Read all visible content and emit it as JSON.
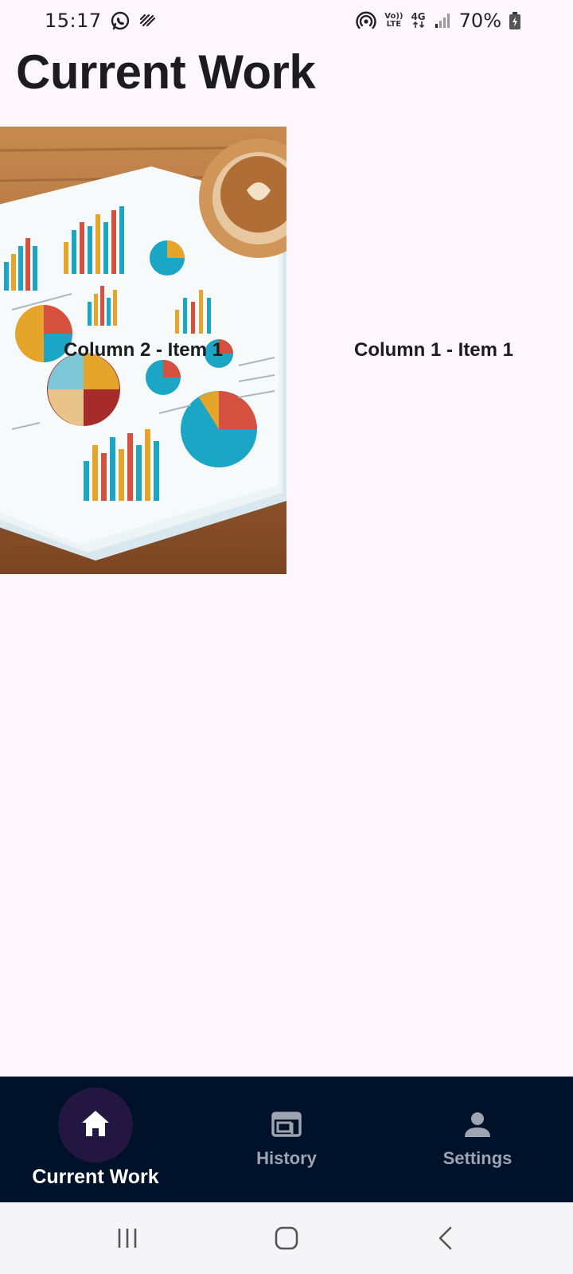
{
  "status_bar": {
    "time": "15:17",
    "volte_top": "Vo))",
    "volte_bottom": "LTE",
    "network": "4G",
    "battery": "70%"
  },
  "page": {
    "title": "Current Work"
  },
  "grid": {
    "left_cell_label": "Column 2 - Item 1",
    "right_cell_label": "Column 1 - Item 1"
  },
  "bottom_nav": {
    "items": [
      {
        "label": "Current Work",
        "icon": "home-icon",
        "active": true
      },
      {
        "label": "History",
        "icon": "web-window-icon",
        "active": false
      },
      {
        "label": "Settings",
        "icon": "person-icon",
        "active": false
      }
    ]
  },
  "colors": {
    "background": "#fdf7fd",
    "nav_background": "#00112a",
    "nav_active_pill": "#231640",
    "nav_inactive": "#9ea4b0"
  }
}
